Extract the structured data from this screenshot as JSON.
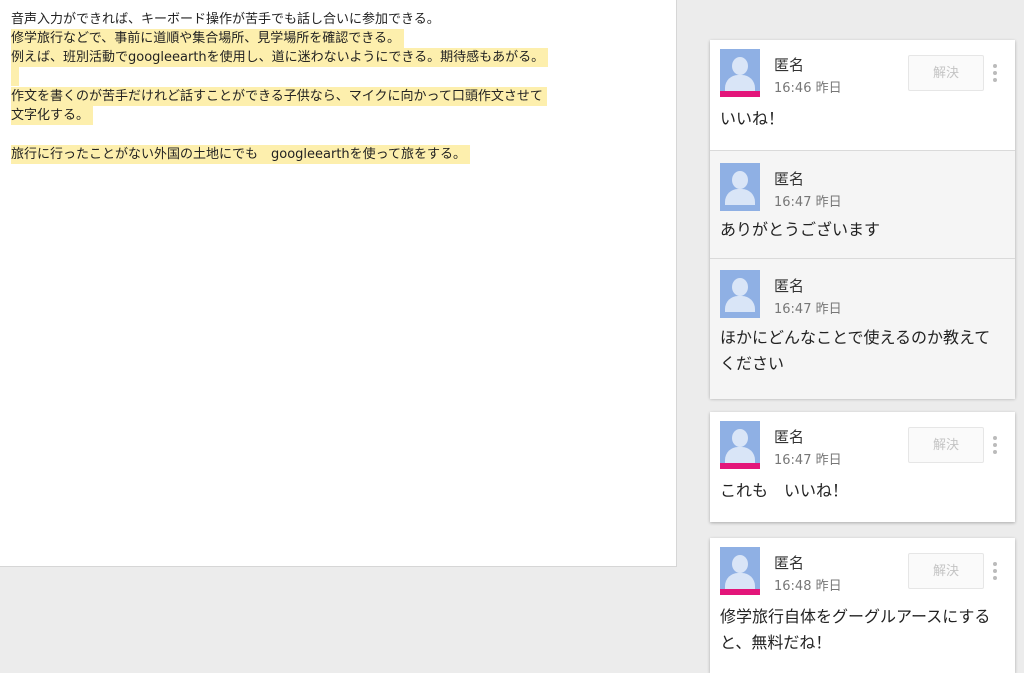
{
  "document": {
    "lines": [
      "音声入力ができれば、キーボード操作が苦手でも話し合いに参加できる。",
      "修学旅行などで、事前に道順や集合場所、見学場所を確認できる。",
      "例えば、班別活動でgoogleearthを使用し、道に迷わないようにできる。期待感もあがる。",
      "作文を書くのが苦手だけれど話すことができる子供なら、マイクに向かって口頭作文させて",
      "文字化する。",
      "旅行に行ったことがない外国の土地にでも　googleearthを使って旅をする。"
    ]
  },
  "comments": [
    {
      "resolve_label": "解決",
      "entries": [
        {
          "author": "匿名",
          "time": "16:46 昨日",
          "text": "いいね！"
        },
        {
          "author": "匿名",
          "time": "16:47 昨日",
          "text": "ありがとうございます"
        },
        {
          "author": "匿名",
          "time": "16:47 昨日",
          "text": "ほかにどんなことで使えるのか教えて\nください"
        }
      ]
    },
    {
      "resolve_label": "解決",
      "entries": [
        {
          "author": "匿名",
          "time": "16:47 昨日",
          "text": "これも　いいね！"
        }
      ]
    },
    {
      "resolve_label": "解決",
      "entries": [
        {
          "author": "匿名",
          "time": "16:48 昨日",
          "text": "修学旅行自体をグーグルアースにする\nと、無料だね！"
        }
      ]
    }
  ],
  "colors": {
    "highlight": "#fdefad",
    "avatar": "#8fb0e4",
    "accent_stripe": "#e3157a"
  }
}
